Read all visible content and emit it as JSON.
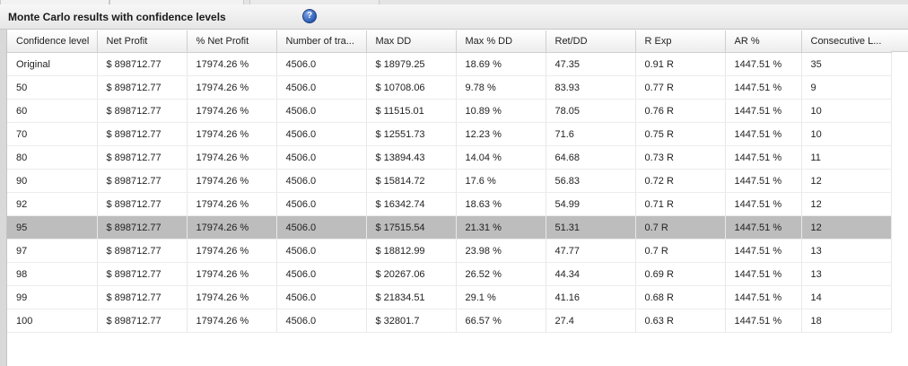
{
  "title": "Monte Carlo results with confidence levels",
  "help_icon": "question-mark",
  "columns": [
    "Confidence level",
    "Net Profit",
    "% Net Profit",
    "Number of tra...",
    "Max DD",
    "Max % DD",
    "Ret/DD",
    "R Exp",
    "AR %",
    "Consecutive L..."
  ],
  "selected_row": "95",
  "colors": {
    "selected_row": "#bdbdbd",
    "help_icon": "#2d5db5"
  },
  "rows": [
    [
      "Original",
      "$ 898712.77",
      "17974.26 %",
      "4506.0",
      "$ 18979.25",
      "18.69 %",
      "47.35",
      "0.91 R",
      "1447.51 %",
      "35"
    ],
    [
      "50",
      "$ 898712.77",
      "17974.26 %",
      "4506.0",
      "$ 10708.06",
      "9.78 %",
      "83.93",
      "0.77 R",
      "1447.51 %",
      "9"
    ],
    [
      "60",
      "$ 898712.77",
      "17974.26 %",
      "4506.0",
      "$ 11515.01",
      "10.89 %",
      "78.05",
      "0.76 R",
      "1447.51 %",
      "10"
    ],
    [
      "70",
      "$ 898712.77",
      "17974.26 %",
      "4506.0",
      "$ 12551.73",
      "12.23 %",
      "71.6",
      "0.75 R",
      "1447.51 %",
      "10"
    ],
    [
      "80",
      "$ 898712.77",
      "17974.26 %",
      "4506.0",
      "$ 13894.43",
      "14.04 %",
      "64.68",
      "0.73 R",
      "1447.51 %",
      "11"
    ],
    [
      "90",
      "$ 898712.77",
      "17974.26 %",
      "4506.0",
      "$ 15814.72",
      "17.6 %",
      "56.83",
      "0.72 R",
      "1447.51 %",
      "12"
    ],
    [
      "92",
      "$ 898712.77",
      "17974.26 %",
      "4506.0",
      "$ 16342.74",
      "18.63 %",
      "54.99",
      "0.71 R",
      "1447.51 %",
      "12"
    ],
    [
      "95",
      "$ 898712.77",
      "17974.26 %",
      "4506.0",
      "$ 17515.54",
      "21.31 %",
      "51.31",
      "0.7 R",
      "1447.51 %",
      "12"
    ],
    [
      "97",
      "$ 898712.77",
      "17974.26 %",
      "4506.0",
      "$ 18812.99",
      "23.98 %",
      "47.77",
      "0.7 R",
      "1447.51 %",
      "13"
    ],
    [
      "98",
      "$ 898712.77",
      "17974.26 %",
      "4506.0",
      "$ 20267.06",
      "26.52 %",
      "44.34",
      "0.69 R",
      "1447.51 %",
      "13"
    ],
    [
      "99",
      "$ 898712.77",
      "17974.26 %",
      "4506.0",
      "$ 21834.51",
      "29.1 %",
      "41.16",
      "0.68 R",
      "1447.51 %",
      "14"
    ],
    [
      "100",
      "$ 898712.77",
      "17974.26 %",
      "4506.0",
      "$ 32801.7",
      "66.57 %",
      "27.4",
      "0.63 R",
      "1447.51 %",
      "18"
    ]
  ]
}
